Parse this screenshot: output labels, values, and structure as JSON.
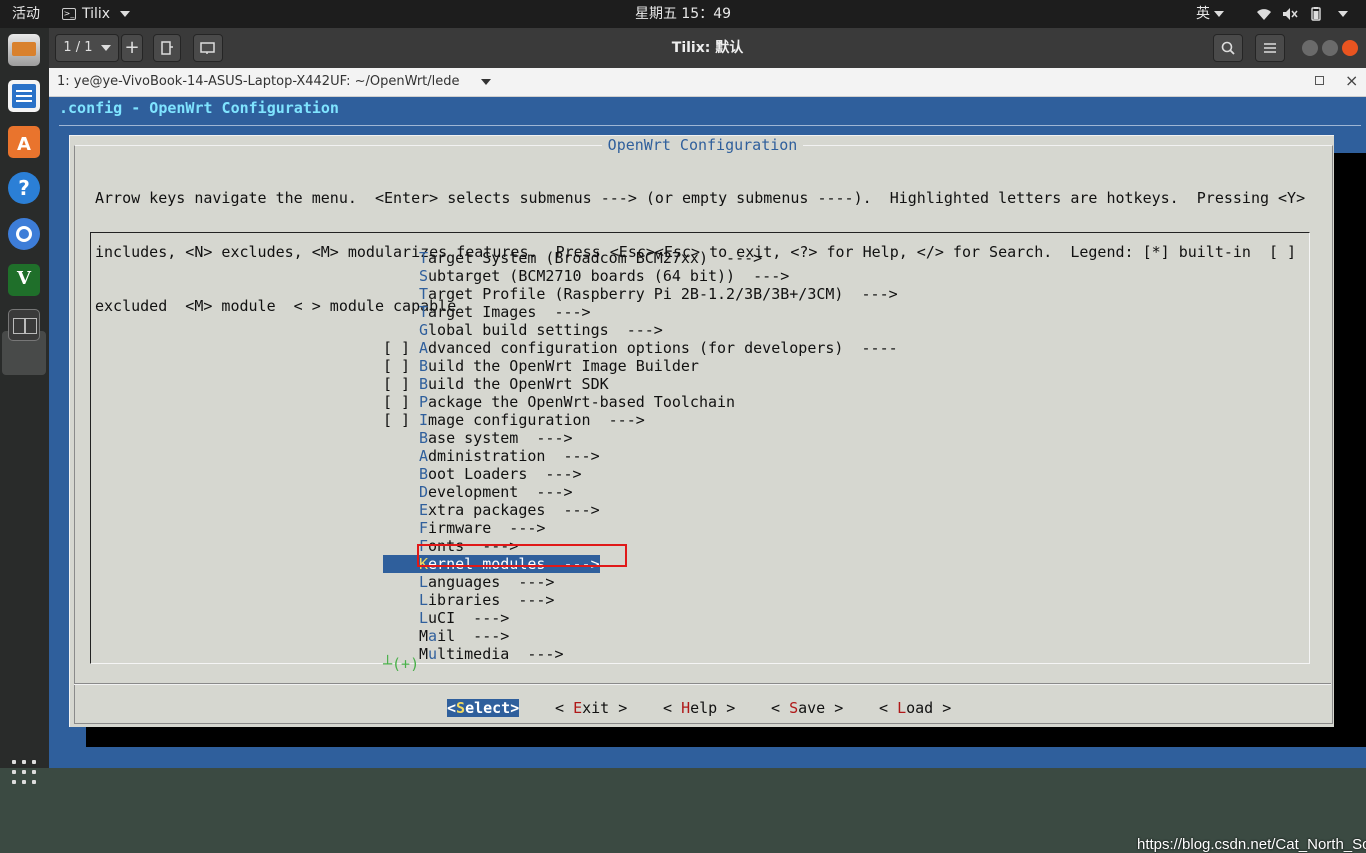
{
  "topbar": {
    "activities": "活动",
    "app_name": "Tilix",
    "clock": "星期五 15：49",
    "ime": "英"
  },
  "dock": {
    "items": [
      "files-app",
      "writer-doc",
      "software-center",
      "help",
      "chromium-browser",
      "vim",
      "tilix-terminal"
    ]
  },
  "tilix": {
    "session_count": "1 / 1",
    "title": "Tilix: 默认",
    "terminal_title": "1: ye@ye-VivoBook-14-ASUS-Laptop-X442UF: ~/OpenWrt/lede"
  },
  "menuconfig": {
    "config_title": ".config - OpenWrt Configuration",
    "dialog_title": "OpenWrt Configuration",
    "help_lines": [
      "Arrow keys navigate the menu.  <Enter> selects submenus ---> (or empty submenus ----).  Highlighted letters are hotkeys.  Pressing <Y>",
      "includes, <N> excludes, <M> modularizes features.  Press <Esc><Esc> to exit, <?> for Help, </> for Search.  Legend: [*] built-in  [ ]",
      "excluded  <M> module  < > module capable"
    ],
    "items": [
      {
        "box": "",
        "hotkey": "T",
        "rest": "arget System (Broadcom BCM27xx)  --->"
      },
      {
        "box": "",
        "hotkey": "S",
        "rest": "ubtarget (BCM2710 boards (64 bit))  --->"
      },
      {
        "box": "",
        "hotkey": "T",
        "rest": "arget Profile (Raspberry Pi 2B-1.2/3B/3B+/3CM)  --->"
      },
      {
        "box": "",
        "hotkey": "T",
        "rest": "arget Images  --->"
      },
      {
        "box": "",
        "hotkey": "G",
        "rest": "lobal build settings  --->"
      },
      {
        "box": "[ ]",
        "hotkey": "A",
        "rest": "dvanced configuration options (for developers)  ----"
      },
      {
        "box": "[ ]",
        "hotkey": "B",
        "rest": "uild the OpenWrt Image Builder"
      },
      {
        "box": "[ ]",
        "hotkey": "B",
        "rest": "uild the OpenWrt SDK"
      },
      {
        "box": "[ ]",
        "hotkey": "P",
        "rest": "ackage the OpenWrt-based Toolchain"
      },
      {
        "box": "[ ]",
        "hotkey": "I",
        "rest": "mage configuration  --->"
      },
      {
        "box": "",
        "hotkey": "B",
        "rest": "ase system  --->"
      },
      {
        "box": "",
        "hotkey": "A",
        "rest": "dministration  --->"
      },
      {
        "box": "",
        "hotkey": "B",
        "rest": "oot Loaders  --->"
      },
      {
        "box": "",
        "hotkey": "D",
        "rest": "evelopment  --->"
      },
      {
        "box": "",
        "hotkey": "E",
        "rest": "xtra packages  --->"
      },
      {
        "box": "",
        "hotkey": "F",
        "rest": "irmware  --->"
      },
      {
        "box": "",
        "hotkey": "F",
        "rest": "onts  --->"
      },
      {
        "box": "",
        "hotkey": "K",
        "rest": "ernel modules  --->"
      },
      {
        "box": "",
        "hotkey": "L",
        "rest": "anguages  --->"
      },
      {
        "box": "",
        "hotkey": "L",
        "rest": "ibraries  --->"
      },
      {
        "box": "",
        "hotkey": "L",
        "rest": "uCI  --->"
      },
      {
        "box": "",
        "pre": "M",
        "hotkey": "a",
        "rest": "il  --->"
      },
      {
        "box": "",
        "pre": "M",
        "hotkey": "u",
        "rest": "ltimedia  --->"
      }
    ],
    "selected_index": 17,
    "more_indicator": "┴(+)",
    "buttons": [
      {
        "pre": "<",
        "hotkey": "S",
        "rest": "elect>"
      },
      {
        "pre": "< ",
        "hotkey": "E",
        "rest": "xit >"
      },
      {
        "pre": "< ",
        "hotkey": "H",
        "rest": "elp >"
      },
      {
        "pre": "< ",
        "hotkey": "S",
        "rest": "ave >"
      },
      {
        "pre": "< ",
        "hotkey": "L",
        "rest": "oad >"
      }
    ],
    "active_button": 0
  },
  "watermark": "https://blog.csdn.net/Cat_North_South",
  "colors": {
    "terminal_bg": "#2f5f9c",
    "dialog_bg": "#d6d7d0",
    "title_cyan": "#7fe4ff",
    "highlight_red": "#e01919"
  }
}
